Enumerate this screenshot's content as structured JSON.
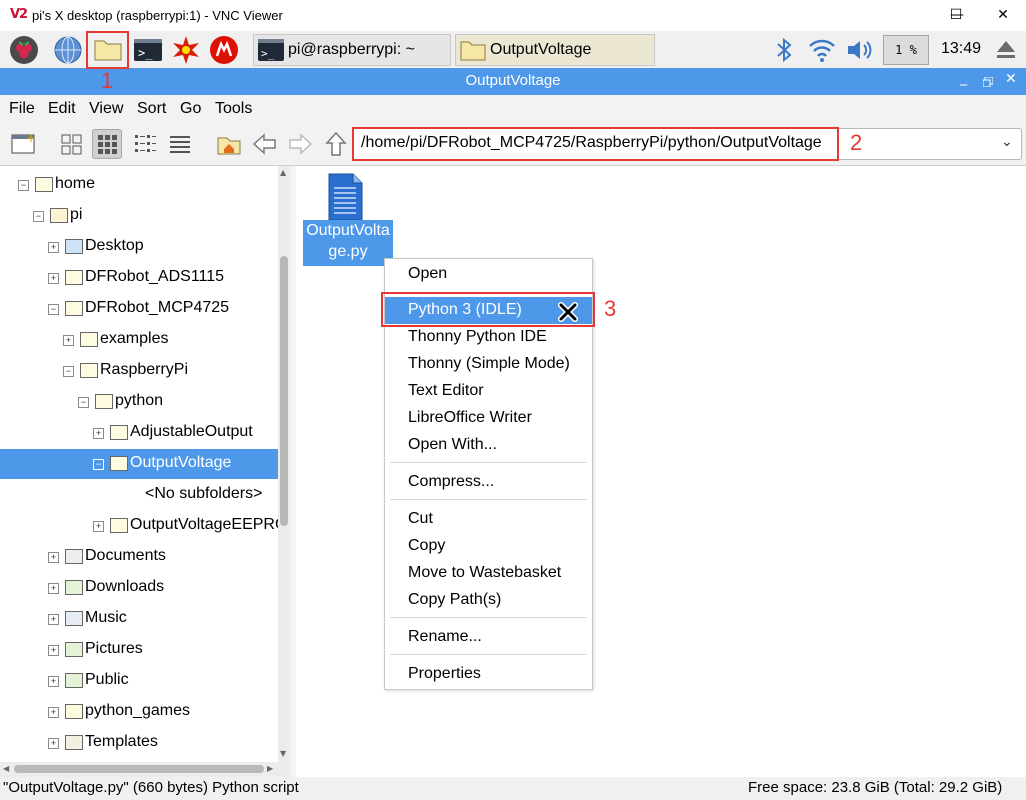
{
  "vnc_window": {
    "logo": "V2",
    "title": "pi's X desktop (raspberrypi:1) - VNC Viewer",
    "minimize_glyph": "—",
    "maximize_glyph": "☐",
    "close_glyph": "✕"
  },
  "taskbar": {
    "tasks": [
      {
        "label": "pi@raspberrypi: ~",
        "icon": "terminal-icon"
      },
      {
        "label": "OutputVoltage",
        "icon": "folder-icon"
      }
    ],
    "cpu_label": "1 %",
    "clock": "13:49"
  },
  "file_manager": {
    "window_title": "OutputVoltage",
    "menu": [
      "File",
      "Edit",
      "View",
      "Sort",
      "Go",
      "Tools"
    ],
    "address": "/home/pi/DFRobot_MCP4725/RaspberryPi/python/OutputVoltage",
    "tree": [
      {
        "label": "home",
        "expander": "−",
        "level": 0
      },
      {
        "label": "pi",
        "expander": "−",
        "level": 1
      },
      {
        "label": "Desktop",
        "expander": "+",
        "level": 2
      },
      {
        "label": "DFRobot_ADS1115",
        "expander": "+",
        "level": 2
      },
      {
        "label": "DFRobot_MCP4725",
        "expander": "−",
        "level": 2
      },
      {
        "label": "examples",
        "expander": "+",
        "level": 3
      },
      {
        "label": "RaspberryPi",
        "expander": "−",
        "level": 3
      },
      {
        "label": "python",
        "expander": "−",
        "level": 4
      },
      {
        "label": "AdjustableOutput",
        "expander": "+",
        "level": 5
      },
      {
        "label": "OutputVoltage",
        "expander": "−",
        "level": 5,
        "selected": true
      },
      {
        "label": "<No subfolders>",
        "expander": "",
        "level": 6
      },
      {
        "label": "OutputVoltageEEPROM",
        "expander": "+",
        "level": 5
      },
      {
        "label": "Documents",
        "expander": "+",
        "level": 2
      },
      {
        "label": "Downloads",
        "expander": "+",
        "level": 2
      },
      {
        "label": "Music",
        "expander": "+",
        "level": 2
      },
      {
        "label": "Pictures",
        "expander": "+",
        "level": 2
      },
      {
        "label": "Public",
        "expander": "+",
        "level": 2
      },
      {
        "label": "python_games",
        "expander": "+",
        "level": 2
      },
      {
        "label": "Templates",
        "expander": "+",
        "level": 2
      }
    ],
    "file": {
      "name_line1": "OutputVolta",
      "name_line2": "ge.py"
    },
    "context_menu": [
      {
        "label": "Open"
      },
      {
        "label": "Python 3 (IDLE)",
        "highlighted": true
      },
      {
        "label": "Thonny Python IDE"
      },
      {
        "label": "Thonny (Simple Mode)"
      },
      {
        "label": "Text Editor"
      },
      {
        "label": "LibreOffice Writer"
      },
      {
        "label": "Open With..."
      },
      {
        "label": "Compress..."
      },
      {
        "label": "Cut"
      },
      {
        "label": "Copy"
      },
      {
        "label": "Move to Wastebasket"
      },
      {
        "label": "Copy Path(s)"
      },
      {
        "label": "Rename..."
      },
      {
        "label": "Properties"
      }
    ],
    "status_left": "\"OutputVoltage.py\" (660 bytes) Python script",
    "status_right": "Free space: 23.8 GiB (Total: 29.2 GiB)"
  },
  "annotations": [
    "1",
    "2",
    "3"
  ],
  "colors": {
    "accent": "#4d98e8",
    "annotation": "#e53935"
  }
}
